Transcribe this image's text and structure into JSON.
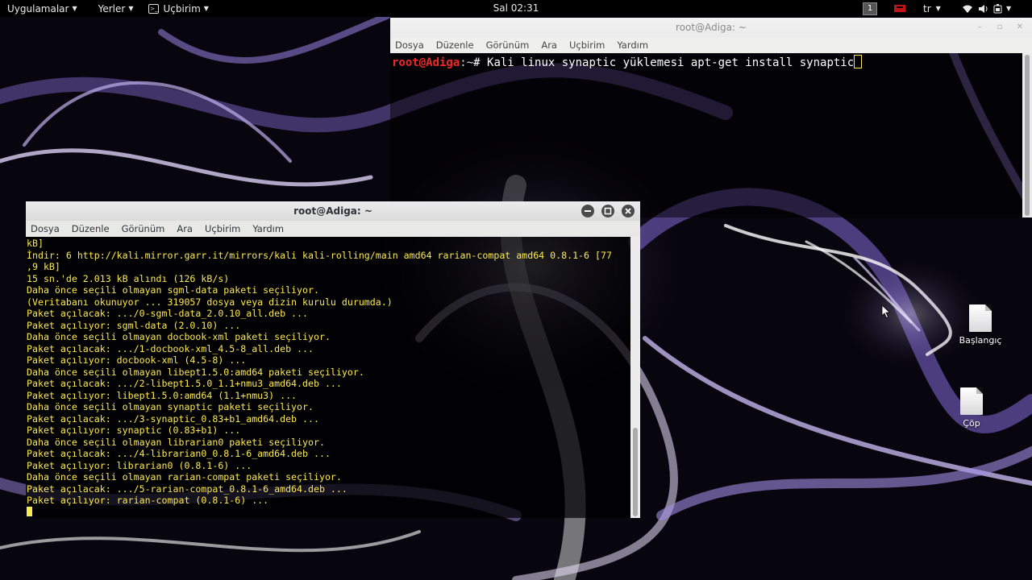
{
  "top_panel": {
    "applications": "Uygulamalar",
    "places": "Yerler",
    "terminal": "Uçbirim",
    "clock": "Sal 02:31",
    "workspace": "1",
    "keyboard_layout": "tr"
  },
  "windows": {
    "back": {
      "title": "root@Adiga: ~",
      "menu": [
        "Dosya",
        "Düzenle",
        "Görünüm",
        "Ara",
        "Uçbirim",
        "Yardım"
      ],
      "prompt_user": "root@Adiga",
      "prompt_path": ":~",
      "prompt_symbol": "# ",
      "command": "Kali linux synaptic yüklemesi apt-get install synaptic"
    },
    "front": {
      "title": "root@Adiga: ~",
      "menu": [
        "Dosya",
        "Düzenle",
        "Görünüm",
        "Ara",
        "Uçbirim",
        "Yardım"
      ],
      "lines": [
        "kB]",
        "İndir: 6 http://kali.mirror.garr.it/mirrors/kali kali-rolling/main amd64 rarian-compat amd64 0.8.1-6 [77",
        ",9 kB]",
        "15 sn.'de 2.013 kB alındı (126 kB/s)",
        "Daha önce seçili olmayan sgml-data paketi seçiliyor.",
        "(Veritabanı okunuyor ... 319057 dosya veya dizin kurulu durumda.)",
        "Paket açılacak: .../0-sgml-data_2.0.10_all.deb ...",
        "Paket açılıyor: sgml-data (2.0.10) ...",
        "Daha önce seçili olmayan docbook-xml paketi seçiliyor.",
        "Paket açılacak: .../1-docbook-xml_4.5-8_all.deb ...",
        "Paket açılıyor: docbook-xml (4.5-8) ...",
        "Daha önce seçili olmayan libept1.5.0:amd64 paketi seçiliyor.",
        "Paket açılacak: .../2-libept1.5.0_1.1+nmu3_amd64.deb ...",
        "Paket açılıyor: libept1.5.0:amd64 (1.1+nmu3) ...",
        "Daha önce seçili olmayan synaptic paketi seçiliyor.",
        "Paket açılacak: .../3-synaptic_0.83+b1_amd64.deb ...",
        "Paket açılıyor: synaptic (0.83+b1) ...",
        "Daha önce seçili olmayan librarian0 paketi seçiliyor.",
        "Paket açılacak: .../4-librarian0_0.8.1-6_amd64.deb ...",
        "Paket açılıyor: librarian0 (0.8.1-6) ...",
        "Daha önce seçili olmayan rarian-compat paketi seçiliyor.",
        "Paket açılacak: .../5-rarian-compat_0.8.1-6_amd64.deb ...",
        "Paket açılıyor: rarian-compat (0.8.1-6) ..."
      ],
      "scroll_position": 1.0
    }
  },
  "desktop_icons": [
    {
      "label": "Başlangıç",
      "icon": "text-file-icon"
    },
    {
      "label": "Çöp",
      "icon": "trash-file-icon"
    }
  ],
  "colors": {
    "terminal_text": "#fce94f",
    "prompt_user": "#ef2929",
    "panel_bg": "#000000"
  }
}
